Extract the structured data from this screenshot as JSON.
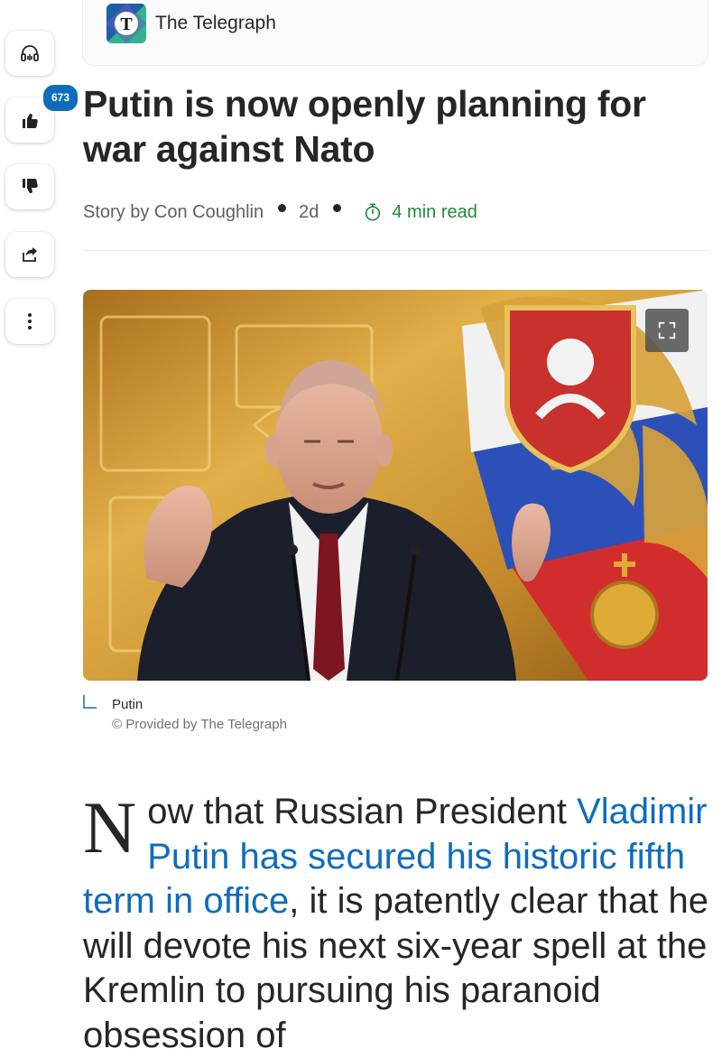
{
  "rail": {
    "like_count": "673"
  },
  "publisher": {
    "name": "The Telegraph",
    "logo_letter": "T"
  },
  "article": {
    "headline": "Putin is now openly planning for war against Nato",
    "byline": "Story by Con Coughlin",
    "age": "2d",
    "read_time": "4 min read"
  },
  "image": {
    "caption": "Putin",
    "credit": "© Provided by The Telegraph"
  },
  "body": {
    "dropcap": "N",
    "text_before_link": "ow that Russian President ",
    "link_text": "Vladimir Putin has secured his historic fifth term in office",
    "text_after_link": ", it is patently clear that he will devote his next six-year spell at the Kremlin to pursuing his paranoid obsession of"
  },
  "colors": {
    "accent_blue": "#0f6cbd",
    "read_time_green": "#1e8a3c"
  }
}
